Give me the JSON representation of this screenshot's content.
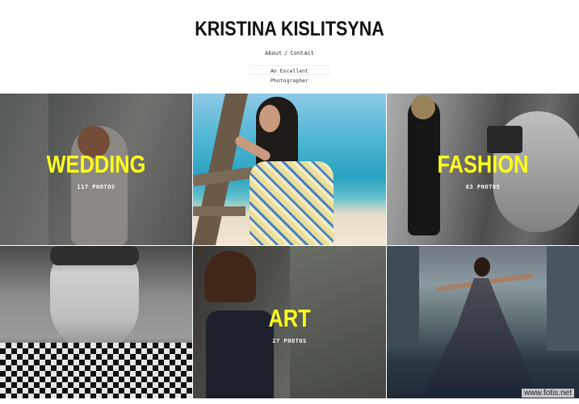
{
  "site": {
    "title": "KRISTINA KISLITSYNA",
    "tagline": "An Excellent Photographer"
  },
  "nav": {
    "items": [
      {
        "label": "About"
      },
      {
        "label": "Contact"
      }
    ],
    "separator": "/"
  },
  "gallery": {
    "tiles": [
      {
        "title": "WEDDING",
        "count": "117 PHOTOS"
      },
      {
        "title": "",
        "count": ""
      },
      {
        "title": "FASHION",
        "count": "63 PHOTOS"
      },
      {
        "title": "",
        "count": ""
      },
      {
        "title": "ART",
        "count": "27 PHOTOS"
      },
      {
        "title": "",
        "count": ""
      }
    ]
  },
  "watermark": "www.fotis.net",
  "colors": {
    "accent": "#ffff1a",
    "title": "#111111",
    "background": "#ffffff"
  }
}
